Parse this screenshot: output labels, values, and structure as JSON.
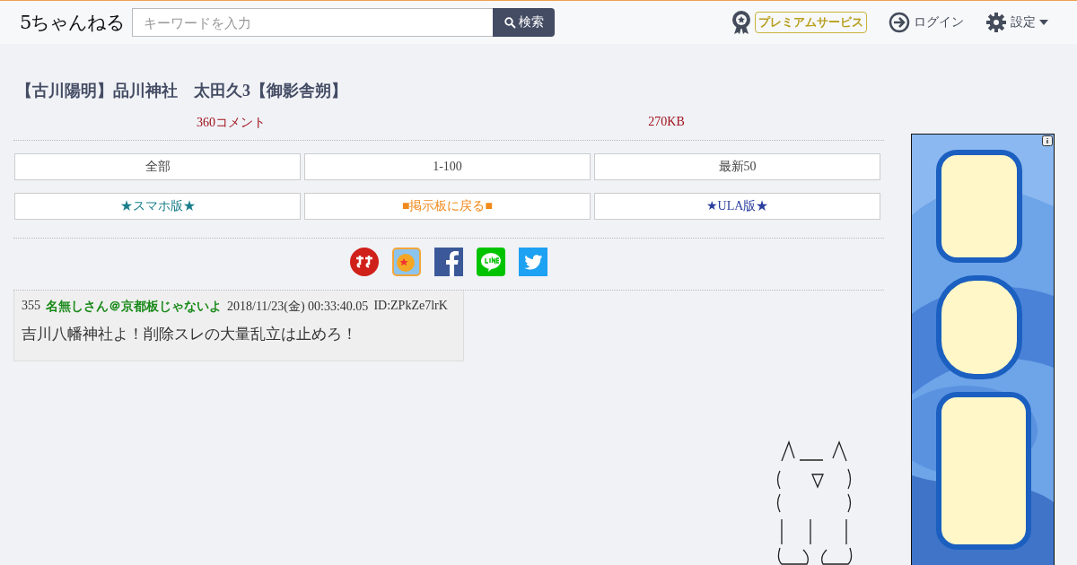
{
  "header": {
    "logo": "5ちゃんねる",
    "search": {
      "placeholder": "キーワードを入力",
      "button": "検索"
    },
    "premium": "プレミアムサービス",
    "login": "ログイン",
    "settings": "設定"
  },
  "thread": {
    "title": "【古川陽明】品川神社　太田久3【御影舎朔】",
    "comments": "360コメント",
    "size": "270KB"
  },
  "nav_buttons": [
    {
      "label": "全部",
      "kind": "plain"
    },
    {
      "label": "1-100",
      "kind": "plain"
    },
    {
      "label": "最新50",
      "kind": "plain"
    },
    {
      "label": "★スマホ版★",
      "kind": "teal"
    },
    {
      "label": "■掲示板に戻る■",
      "kind": "orange"
    },
    {
      "label": "★ULA版★",
      "kind": "blue"
    }
  ],
  "share": [
    {
      "kind": "sumaho"
    },
    {
      "kind": "app"
    },
    {
      "kind": "facebook"
    },
    {
      "kind": "line"
    },
    {
      "kind": "twitter"
    }
  ],
  "posts": [
    {
      "number": "355",
      "name": "名無しさん＠京都板じゃないよ",
      "date": "2018/11/23(金) 00:33:40.05",
      "id": "ID:ZPkZe7lrK",
      "body": "吉川八幡神社よ！削除スレの大量乱立は止めろ！"
    }
  ]
}
